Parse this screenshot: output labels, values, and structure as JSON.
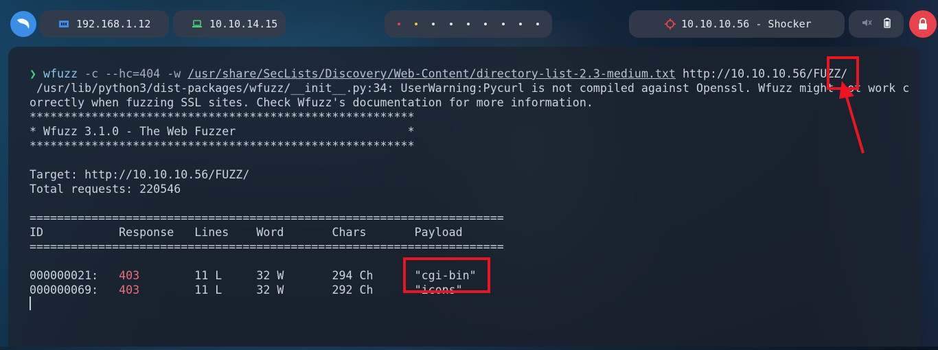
{
  "topbar": {
    "logo_icon": "kali-dragon-icon",
    "local_ip": "192.168.1.12",
    "vpn_ip": "10.10.14.15",
    "workspaces": [
      "1",
      "2",
      "3",
      "4",
      "5",
      "6",
      "7",
      "8",
      "9"
    ],
    "workspace_colors": [
      "#e8434a",
      "#f5c542",
      "#dfe3ea"
    ],
    "target": "10.10.10.56 - Shocker",
    "sys_icons": [
      "speaker-muted-icon",
      "battery-icon"
    ],
    "power_icon": "lock-icon",
    "accent_color": "#e8434a"
  },
  "terminal": {
    "prompt_symbol": "❯",
    "command": "wfuzz",
    "args_pre": " -c --hc=404 -w ",
    "wordlist": "/usr/share/SecLists/Discovery/Web-Content/directory-list-2.3-medium.txt",
    "url": " http://10.10.10.56/FUZZ/",
    "warning_1": " /usr/lib/python3/dist-packages/wfuzz/__init__.py:34: UserWarning:Pycurl is not compiled against Openssl. Wfuzz might not work c",
    "warning_2": "orrectly when fuzzing SSL sites. Check Wfuzz's documentation for more information.",
    "banner_border": "********************************************************",
    "banner_text": "* Wfuzz 3.1.0 - The Web Fuzzer                         *",
    "target_line": "Target: http://10.10.10.56/FUZZ/",
    "total_line": "Total requests: 220546",
    "separator": "=====================================================================",
    "header": "ID           Response   Lines    Word       Chars       Payload",
    "results": [
      {
        "id": "000000021:   ",
        "code": "403",
        "rest": "        11 L     32 W       294 Ch      \"cgi-bin\""
      },
      {
        "id": "000000069:   ",
        "code": "403",
        "rest": "        11 L     32 W       292 Ch      \"icons\""
      }
    ]
  }
}
